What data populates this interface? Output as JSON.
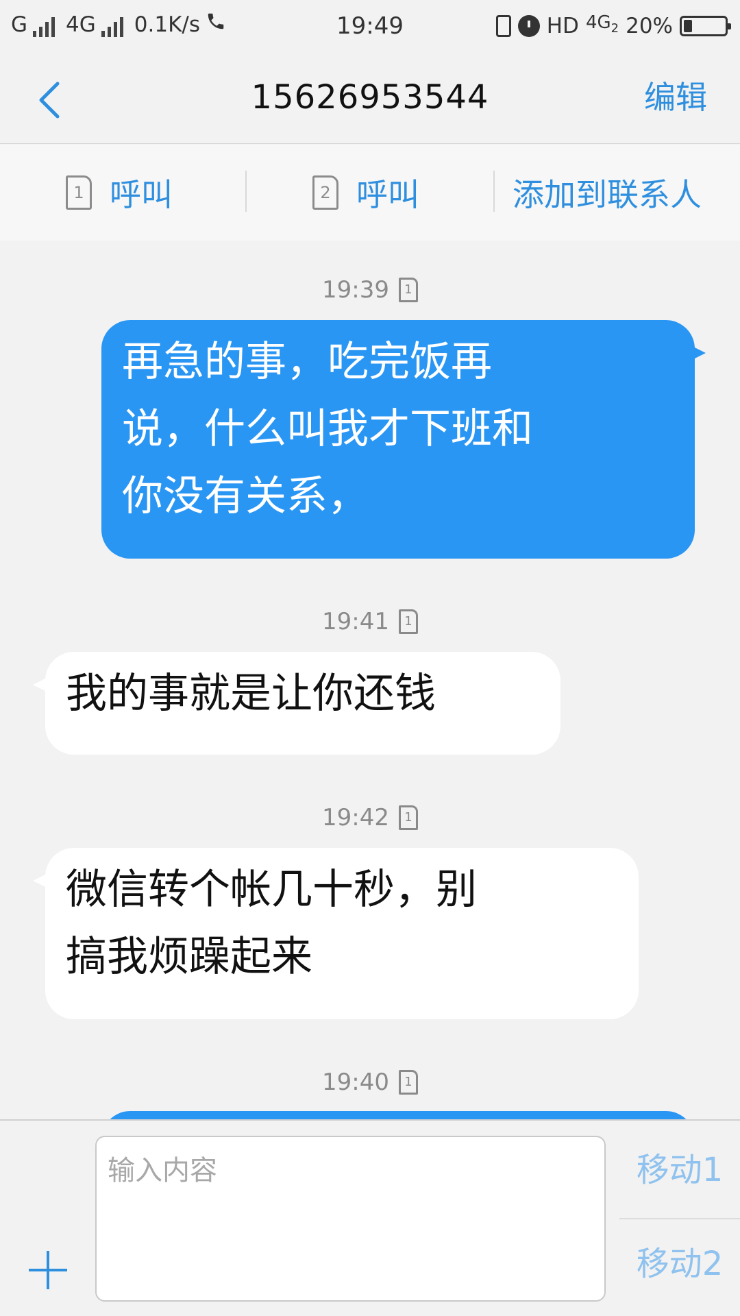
{
  "status_bar": {
    "carrier1": "G",
    "carrier2": "4G",
    "speed": "0.1K/s",
    "time": "19:49",
    "hd": "HD",
    "network": "4G",
    "network_sub": "2",
    "battery_text": "20%",
    "battery_level": 0.2
  },
  "header": {
    "title": "15626953544",
    "edit_label": "编辑"
  },
  "actions": {
    "call1_label": "呼叫",
    "call1_sim": "1",
    "call2_label": "呼叫",
    "call2_sim": "2",
    "add_contact_label": "添加到联系人"
  },
  "messages": [
    {
      "time": "19:39",
      "sim": "1",
      "direction": "outgoing",
      "lines": [
        "再急的事，吃完饭再",
        "说，什么叫我才下班和",
        "你没有关系，"
      ]
    },
    {
      "time": "19:41",
      "sim": "1",
      "direction": "incoming",
      "lines": [
        "我的事就是让你还钱"
      ]
    },
    {
      "time": "19:42",
      "sim": "1",
      "direction": "incoming",
      "lines": [
        "微信转个帐几十秒，别",
        "搞我烦躁起来"
      ]
    },
    {
      "time": "19:40",
      "sim": "1",
      "direction": "outgoing",
      "lines": []
    }
  ],
  "composer": {
    "placeholder": "输入内容",
    "send1_label": "移动1",
    "send2_label": "移动2"
  },
  "colors": {
    "accent": "#2f8fdf",
    "outgoing_bubble": "#2a96f4",
    "incoming_bubble": "#ffffff",
    "background": "#f2f2f2"
  },
  "icons": [
    "back-chevron-icon",
    "sim-icon",
    "vibrate-icon",
    "alarm-icon",
    "battery-icon",
    "call-icon",
    "plus-icon"
  ]
}
